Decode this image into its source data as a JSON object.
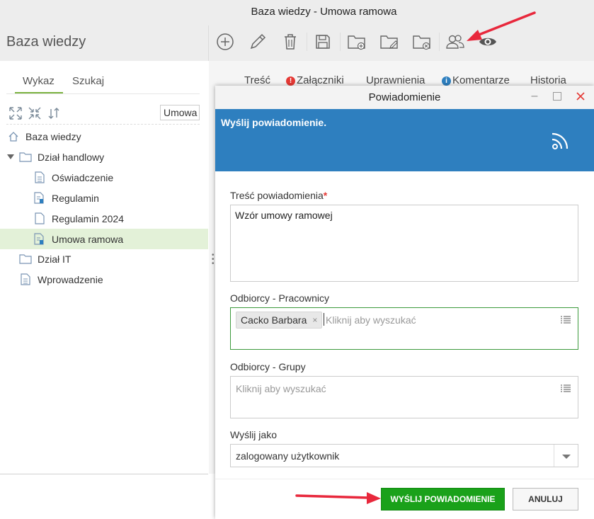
{
  "window": {
    "title": "Baza wiedzy - Umowa ramowa"
  },
  "app": {
    "title": "Baza wiedzy"
  },
  "toolbar": {
    "icons": [
      "add-circle-icon",
      "pencil-icon",
      "trash-icon",
      "save-icon",
      "folder-add-icon",
      "folder-edit-icon",
      "folder-delete-icon",
      "users-icon",
      "eye-icon"
    ]
  },
  "sidebar": {
    "tabs": [
      {
        "label": "Wykaz",
        "active": true
      },
      {
        "label": "Szukaj",
        "active": false
      }
    ],
    "filter_value": "Umowa",
    "tree": [
      {
        "label": "Baza wiedzy",
        "icon": "home-icon"
      },
      {
        "label": "Dział handlowy",
        "icon": "folder-icon",
        "expanded": true
      },
      {
        "label": "Oświadczenie",
        "icon": "document-icon"
      },
      {
        "label": "Regulamin",
        "icon": "document-key-icon"
      },
      {
        "label": "Regulamin 2024",
        "icon": "document-blank-icon"
      },
      {
        "label": "Umowa ramowa",
        "icon": "document-key-icon",
        "selected": true
      },
      {
        "label": "Dział IT",
        "icon": "folder-icon"
      },
      {
        "label": "Wprowadzenie",
        "icon": "document-icon"
      }
    ]
  },
  "content_tabs": [
    {
      "label": "Treść"
    },
    {
      "label": "Załączniki",
      "badge": "!"
    },
    {
      "label": "Uprawnienia"
    },
    {
      "label": "Komentarze",
      "badge": "i"
    },
    {
      "label": "Historia"
    }
  ],
  "dialog": {
    "title": "Powiadomienie",
    "banner_title": "Wyślij powiadomienie.",
    "message_label": "Treść powiadomienia",
    "message_required": "*",
    "message_value": "Wzór umowy ramowej",
    "employees_label": "Odbiorcy - Pracownicy",
    "employees_selected": [
      "Cacko Barbara"
    ],
    "employees_chip_remove": "×",
    "picker_placeholder": "Kliknij aby wyszukać",
    "groups_label": "Odbiorcy - Grupy",
    "send_as_label": "Wyślij jako",
    "send_as_value": "zalogowany użytkownik",
    "send_button": "WYŚLIJ POWIADOMIENIE",
    "cancel_button": "ANULUJ"
  },
  "colors": {
    "banner": "#2e7fbf",
    "send_button": "#1aa11a",
    "selected_row": "#e3f1d8",
    "accent_tab": "#7cb342",
    "annotation_arrow": "#e8283c"
  }
}
